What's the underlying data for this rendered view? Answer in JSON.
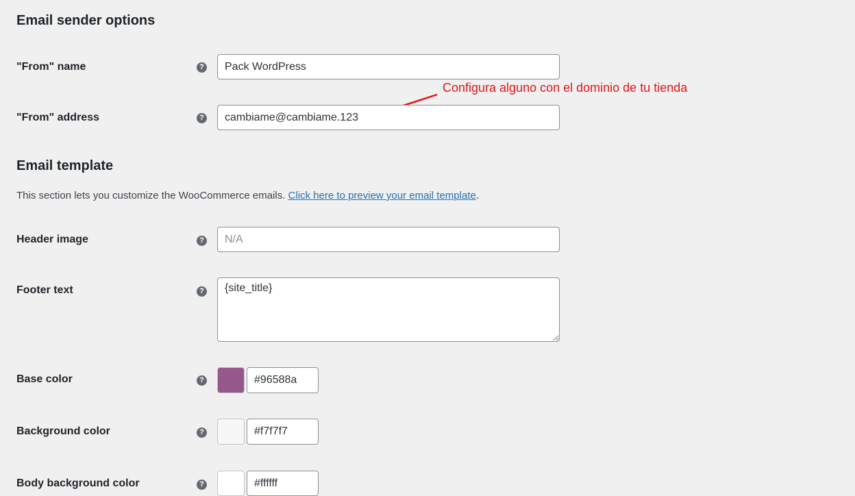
{
  "sender_section": {
    "title": "Email sender options",
    "from_name": {
      "label": "\"From\" name",
      "value": "Pack WordPress"
    },
    "from_address": {
      "label": "\"From\" address",
      "value": "cambiame@cambiame.123"
    }
  },
  "annotation": {
    "text": "Configura alguno con el dominio de tu tienda",
    "color": "#e3151a"
  },
  "template_section": {
    "title": "Email template",
    "description": "This section lets you customize the WooCommerce emails.",
    "preview_link": "Click here to preview your email template",
    "description_end": ".",
    "header_image": {
      "label": "Header image",
      "placeholder": "N/A"
    },
    "footer_text": {
      "label": "Footer text",
      "value": "{site_title}"
    },
    "base_color": {
      "label": "Base color",
      "value": "#96588a"
    },
    "background_color": {
      "label": "Background color",
      "value": "#f7f7f7"
    },
    "body_background_color": {
      "label": "Body background color",
      "value": "#ffffff"
    }
  },
  "help_icon": {
    "glyph": "?",
    "icon": "help-icon"
  },
  "colors": {
    "link": "#2271b1",
    "page_background": "#f0f0f1"
  }
}
